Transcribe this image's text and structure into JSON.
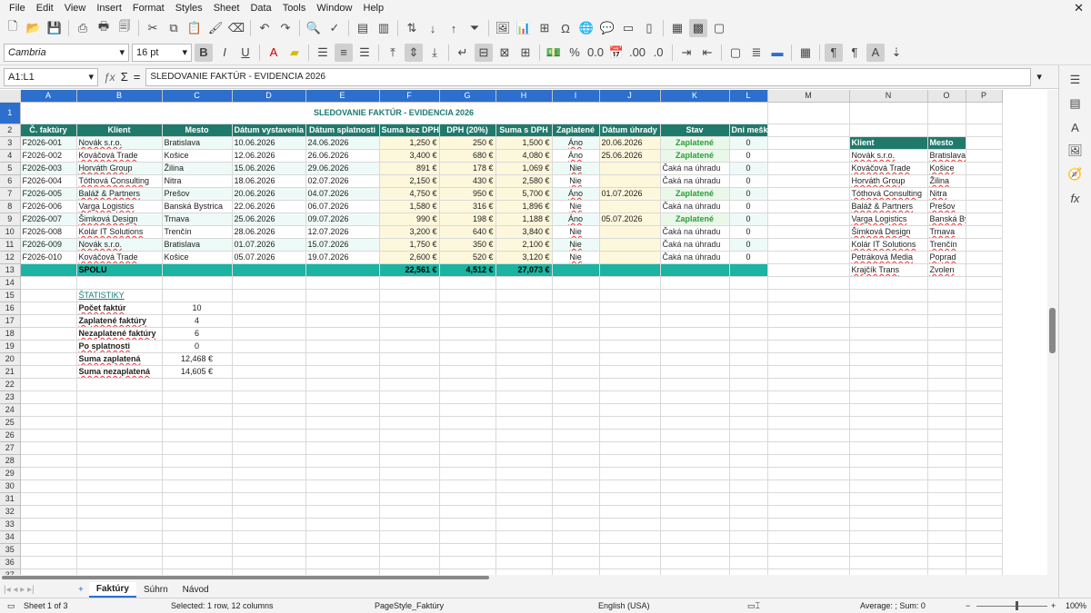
{
  "menu": [
    "File",
    "Edit",
    "View",
    "Insert",
    "Format",
    "Styles",
    "Sheet",
    "Data",
    "Tools",
    "Window",
    "Help"
  ],
  "font": {
    "name": "Cambria",
    "size": "16 pt"
  },
  "namebox": "A1:L1",
  "formula": "SLEDOVANIE FAKTÚR - EVIDENCIA 2026",
  "columns": [
    "A",
    "B",
    "C",
    "D",
    "E",
    "F",
    "G",
    "H",
    "I",
    "J",
    "K",
    "L",
    "M",
    "N",
    "O",
    "P",
    "Q"
  ],
  "title": "SLEDOVANIE FAKTÚR - EVIDENCIA 2026",
  "headers": [
    "Č. faktúry",
    "Klient",
    "Mesto",
    "Dátum vystavenia",
    "Dátum splatnosti",
    "Suma bez DPH",
    "DPH (20%)",
    "Suma s DPH",
    "Zaplatené",
    "Dátum úhrady",
    "Stav",
    "Dni meškania"
  ],
  "rows": [
    [
      "F2026-001",
      "Novák s.r.o.",
      "Bratislava",
      "10.06.2026",
      "24.06.2026",
      "1,250 €",
      "250 €",
      "1,500 €",
      "Áno",
      "20.06.2026",
      "Zaplatené",
      "0"
    ],
    [
      "F2026-002",
      "Kováčová Trade",
      "Košice",
      "12.06.2026",
      "26.06.2026",
      "3,400 €",
      "680 €",
      "4,080 €",
      "Áno",
      "25.06.2026",
      "Zaplatené",
      "0"
    ],
    [
      "F2026-003",
      "Horváth Group",
      "Žilina",
      "15.06.2026",
      "29.06.2026",
      "891 €",
      "178 €",
      "1,069 €",
      "Nie",
      "",
      "Čaká na úhradu",
      "0"
    ],
    [
      "F2026-004",
      "Tóthová Consulting",
      "Nitra",
      "18.06.2026",
      "02.07.2026",
      "2,150 €",
      "430 €",
      "2,580 €",
      "Nie",
      "",
      "Čaká na úhradu",
      "0"
    ],
    [
      "F2026-005",
      "Baláž & Partners",
      "Prešov",
      "20.06.2026",
      "04.07.2026",
      "4,750 €",
      "950 €",
      "5,700 €",
      "Áno",
      "01.07.2026",
      "Zaplatené",
      "0"
    ],
    [
      "F2026-006",
      "Varga Logistics",
      "Banská Bystrica",
      "22.06.2026",
      "06.07.2026",
      "1,580 €",
      "316 €",
      "1,896 €",
      "Nie",
      "",
      "Čaká na úhradu",
      "0"
    ],
    [
      "F2026-007",
      "Šimková Design",
      "Trnava",
      "25.06.2026",
      "09.07.2026",
      "990 €",
      "198 €",
      "1,188 €",
      "Áno",
      "05.07.2026",
      "Zaplatené",
      "0"
    ],
    [
      "F2026-008",
      "Kolár IT Solutions",
      "Trenčín",
      "28.06.2026",
      "12.07.2026",
      "3,200 €",
      "640 €",
      "3,840 €",
      "Nie",
      "",
      "Čaká na úhradu",
      "0"
    ],
    [
      "F2026-009",
      "Novák s.r.o.",
      "Bratislava",
      "01.07.2026",
      "15.07.2026",
      "1,750 €",
      "350 €",
      "2,100 €",
      "Nie",
      "",
      "Čaká na úhradu",
      "0"
    ],
    [
      "F2026-010",
      "Kováčová Trade",
      "Košice",
      "05.07.2026",
      "19.07.2026",
      "2,600 €",
      "520 €",
      "3,120 €",
      "Nie",
      "",
      "Čaká na úhradu",
      "0"
    ]
  ],
  "total": {
    "label": "SPOLU",
    "net": "22,561 €",
    "vat": "4,512 €",
    "gross": "27,073 €"
  },
  "stats": {
    "title": "ŠTATISTIKY",
    "items": [
      [
        "Počet faktúr",
        "10"
      ],
      [
        "Zaplatené faktúry",
        "4"
      ],
      [
        "Nezaplatené faktúry",
        "6"
      ],
      [
        "Po splatnosti",
        "0"
      ],
      [
        "Suma zaplatená",
        "12,468 €"
      ],
      [
        "Suma nezaplatená",
        "14,605 €"
      ]
    ]
  },
  "lookup": {
    "headers": [
      "Klient",
      "Mesto"
    ],
    "rows": [
      [
        "Novák s.r.o.",
        "Bratislava"
      ],
      [
        "Kováčová Trade",
        "Košice"
      ],
      [
        "Horváth Group",
        "Žilina"
      ],
      [
        "Tóthová Consulting",
        "Nitra"
      ],
      [
        "Baláž & Partners",
        "Prešov"
      ],
      [
        "Varga Logistics",
        "Banská Bystrica"
      ],
      [
        "Šimková Design",
        "Trnava"
      ],
      [
        "Kolár IT Solutions",
        "Trenčín"
      ],
      [
        "Petráková Media",
        "Poprad"
      ],
      [
        "Krajčík Trans",
        "Zvolen"
      ]
    ]
  },
  "tabs": [
    "Faktúry",
    "Súhrn",
    "Návod"
  ],
  "status": {
    "sheet": "Sheet 1 of 3",
    "selected": "Selected: 1 row, 12 columns",
    "style": "PageStyle_Faktúry",
    "lang": "English (USA)",
    "sum": "Average: ; Sum: 0",
    "zoom": "100%"
  },
  "colors": {
    "header": "#207a6c",
    "total": "#1bb3a1",
    "accent": "#2c6fcd",
    "paid": "#2aa035"
  }
}
